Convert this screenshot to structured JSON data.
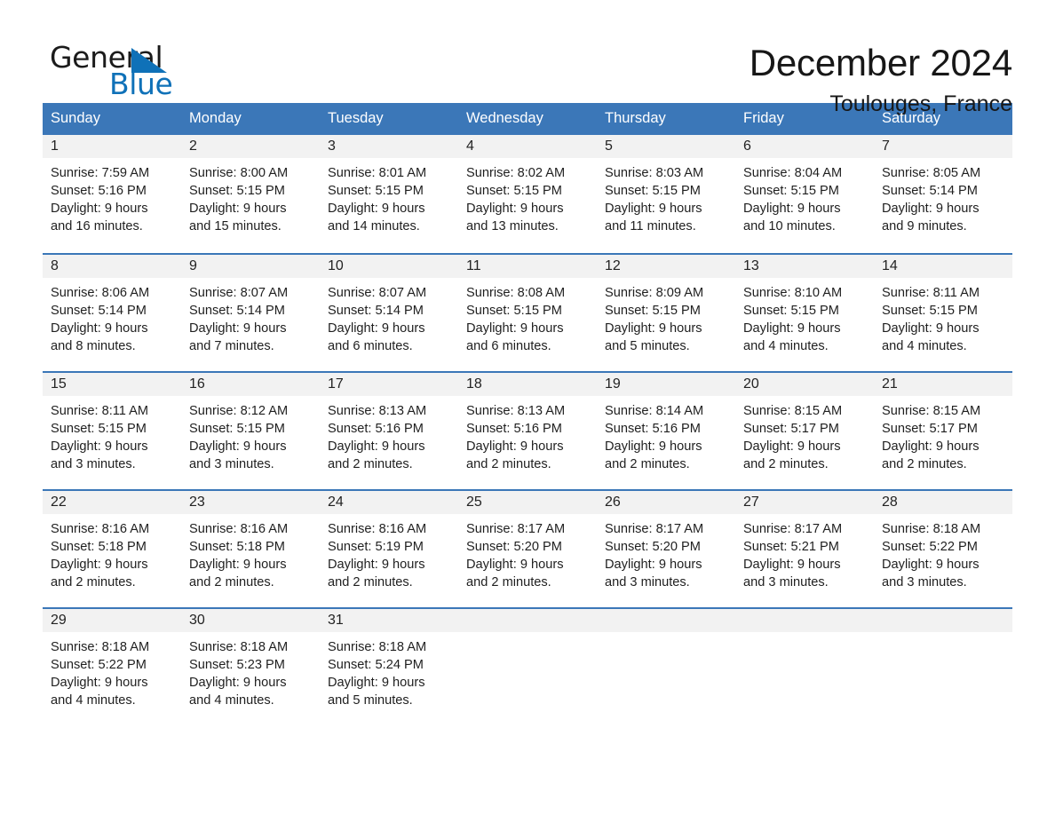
{
  "brand": {
    "name_part1": "General",
    "name_part2": "Blue",
    "triangle_color": "#0f71b8",
    "accent_color": "#3b77b8"
  },
  "header": {
    "title": "December 2024",
    "subtitle": "Toulouges, France"
  },
  "calendar": {
    "weekday_headers": [
      "Sunday",
      "Monday",
      "Tuesday",
      "Wednesday",
      "Thursday",
      "Friday",
      "Saturday"
    ],
    "weeks": [
      [
        {
          "day": "1",
          "sunrise": "Sunrise: 7:59 AM",
          "sunset": "Sunset: 5:16 PM",
          "daylight_line1": "Daylight: 9 hours",
          "daylight_line2": "and 16 minutes."
        },
        {
          "day": "2",
          "sunrise": "Sunrise: 8:00 AM",
          "sunset": "Sunset: 5:15 PM",
          "daylight_line1": "Daylight: 9 hours",
          "daylight_line2": "and 15 minutes."
        },
        {
          "day": "3",
          "sunrise": "Sunrise: 8:01 AM",
          "sunset": "Sunset: 5:15 PM",
          "daylight_line1": "Daylight: 9 hours",
          "daylight_line2": "and 14 minutes."
        },
        {
          "day": "4",
          "sunrise": "Sunrise: 8:02 AM",
          "sunset": "Sunset: 5:15 PM",
          "daylight_line1": "Daylight: 9 hours",
          "daylight_line2": "and 13 minutes."
        },
        {
          "day": "5",
          "sunrise": "Sunrise: 8:03 AM",
          "sunset": "Sunset: 5:15 PM",
          "daylight_line1": "Daylight: 9 hours",
          "daylight_line2": "and 11 minutes."
        },
        {
          "day": "6",
          "sunrise": "Sunrise: 8:04 AM",
          "sunset": "Sunset: 5:15 PM",
          "daylight_line1": "Daylight: 9 hours",
          "daylight_line2": "and 10 minutes."
        },
        {
          "day": "7",
          "sunrise": "Sunrise: 8:05 AM",
          "sunset": "Sunset: 5:14 PM",
          "daylight_line1": "Daylight: 9 hours",
          "daylight_line2": "and 9 minutes."
        }
      ],
      [
        {
          "day": "8",
          "sunrise": "Sunrise: 8:06 AM",
          "sunset": "Sunset: 5:14 PM",
          "daylight_line1": "Daylight: 9 hours",
          "daylight_line2": "and 8 minutes."
        },
        {
          "day": "9",
          "sunrise": "Sunrise: 8:07 AM",
          "sunset": "Sunset: 5:14 PM",
          "daylight_line1": "Daylight: 9 hours",
          "daylight_line2": "and 7 minutes."
        },
        {
          "day": "10",
          "sunrise": "Sunrise: 8:07 AM",
          "sunset": "Sunset: 5:14 PM",
          "daylight_line1": "Daylight: 9 hours",
          "daylight_line2": "and 6 minutes."
        },
        {
          "day": "11",
          "sunrise": "Sunrise: 8:08 AM",
          "sunset": "Sunset: 5:15 PM",
          "daylight_line1": "Daylight: 9 hours",
          "daylight_line2": "and 6 minutes."
        },
        {
          "day": "12",
          "sunrise": "Sunrise: 8:09 AM",
          "sunset": "Sunset: 5:15 PM",
          "daylight_line1": "Daylight: 9 hours",
          "daylight_line2": "and 5 minutes."
        },
        {
          "day": "13",
          "sunrise": "Sunrise: 8:10 AM",
          "sunset": "Sunset: 5:15 PM",
          "daylight_line1": "Daylight: 9 hours",
          "daylight_line2": "and 4 minutes."
        },
        {
          "day": "14",
          "sunrise": "Sunrise: 8:11 AM",
          "sunset": "Sunset: 5:15 PM",
          "daylight_line1": "Daylight: 9 hours",
          "daylight_line2": "and 4 minutes."
        }
      ],
      [
        {
          "day": "15",
          "sunrise": "Sunrise: 8:11 AM",
          "sunset": "Sunset: 5:15 PM",
          "daylight_line1": "Daylight: 9 hours",
          "daylight_line2": "and 3 minutes."
        },
        {
          "day": "16",
          "sunrise": "Sunrise: 8:12 AM",
          "sunset": "Sunset: 5:15 PM",
          "daylight_line1": "Daylight: 9 hours",
          "daylight_line2": "and 3 minutes."
        },
        {
          "day": "17",
          "sunrise": "Sunrise: 8:13 AM",
          "sunset": "Sunset: 5:16 PM",
          "daylight_line1": "Daylight: 9 hours",
          "daylight_line2": "and 2 minutes."
        },
        {
          "day": "18",
          "sunrise": "Sunrise: 8:13 AM",
          "sunset": "Sunset: 5:16 PM",
          "daylight_line1": "Daylight: 9 hours",
          "daylight_line2": "and 2 minutes."
        },
        {
          "day": "19",
          "sunrise": "Sunrise: 8:14 AM",
          "sunset": "Sunset: 5:16 PM",
          "daylight_line1": "Daylight: 9 hours",
          "daylight_line2": "and 2 minutes."
        },
        {
          "day": "20",
          "sunrise": "Sunrise: 8:15 AM",
          "sunset": "Sunset: 5:17 PM",
          "daylight_line1": "Daylight: 9 hours",
          "daylight_line2": "and 2 minutes."
        },
        {
          "day": "21",
          "sunrise": "Sunrise: 8:15 AM",
          "sunset": "Sunset: 5:17 PM",
          "daylight_line1": "Daylight: 9 hours",
          "daylight_line2": "and 2 minutes."
        }
      ],
      [
        {
          "day": "22",
          "sunrise": "Sunrise: 8:16 AM",
          "sunset": "Sunset: 5:18 PM",
          "daylight_line1": "Daylight: 9 hours",
          "daylight_line2": "and 2 minutes."
        },
        {
          "day": "23",
          "sunrise": "Sunrise: 8:16 AM",
          "sunset": "Sunset: 5:18 PM",
          "daylight_line1": "Daylight: 9 hours",
          "daylight_line2": "and 2 minutes."
        },
        {
          "day": "24",
          "sunrise": "Sunrise: 8:16 AM",
          "sunset": "Sunset: 5:19 PM",
          "daylight_line1": "Daylight: 9 hours",
          "daylight_line2": "and 2 minutes."
        },
        {
          "day": "25",
          "sunrise": "Sunrise: 8:17 AM",
          "sunset": "Sunset: 5:20 PM",
          "daylight_line1": "Daylight: 9 hours",
          "daylight_line2": "and 2 minutes."
        },
        {
          "day": "26",
          "sunrise": "Sunrise: 8:17 AM",
          "sunset": "Sunset: 5:20 PM",
          "daylight_line1": "Daylight: 9 hours",
          "daylight_line2": "and 3 minutes."
        },
        {
          "day": "27",
          "sunrise": "Sunrise: 8:17 AM",
          "sunset": "Sunset: 5:21 PM",
          "daylight_line1": "Daylight: 9 hours",
          "daylight_line2": "and 3 minutes."
        },
        {
          "day": "28",
          "sunrise": "Sunrise: 8:18 AM",
          "sunset": "Sunset: 5:22 PM",
          "daylight_line1": "Daylight: 9 hours",
          "daylight_line2": "and 3 minutes."
        }
      ],
      [
        {
          "day": "29",
          "sunrise": "Sunrise: 8:18 AM",
          "sunset": "Sunset: 5:22 PM",
          "daylight_line1": "Daylight: 9 hours",
          "daylight_line2": "and 4 minutes."
        },
        {
          "day": "30",
          "sunrise": "Sunrise: 8:18 AM",
          "sunset": "Sunset: 5:23 PM",
          "daylight_line1": "Daylight: 9 hours",
          "daylight_line2": "and 4 minutes."
        },
        {
          "day": "31",
          "sunrise": "Sunrise: 8:18 AM",
          "sunset": "Sunset: 5:24 PM",
          "daylight_line1": "Daylight: 9 hours",
          "daylight_line2": "and 5 minutes."
        },
        {
          "day": "",
          "sunrise": "",
          "sunset": "",
          "daylight_line1": "",
          "daylight_line2": ""
        },
        {
          "day": "",
          "sunrise": "",
          "sunset": "",
          "daylight_line1": "",
          "daylight_line2": ""
        },
        {
          "day": "",
          "sunrise": "",
          "sunset": "",
          "daylight_line1": "",
          "daylight_line2": ""
        },
        {
          "day": "",
          "sunrise": "",
          "sunset": "",
          "daylight_line1": "",
          "daylight_line2": ""
        }
      ]
    ]
  }
}
